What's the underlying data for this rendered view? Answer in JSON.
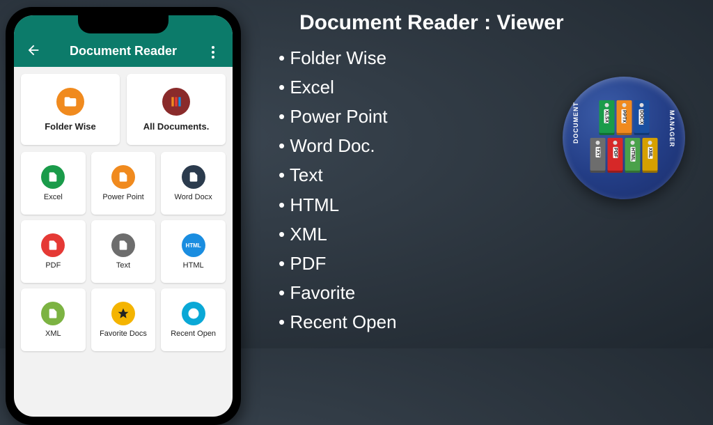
{
  "colors": {
    "header": "#0c7b6a",
    "orange": "#f08a1e",
    "maroon": "#8a2b2b",
    "green": "#1a9b4a",
    "dark": "#2b3b4d",
    "red": "#e53935",
    "gray": "#6d6d6d",
    "blue": "#1a8de0",
    "lime": "#7cb342",
    "yellow": "#f4b400",
    "cyan": "#0aa8d6"
  },
  "phone": {
    "header_title": "Document Reader",
    "top_cards": [
      {
        "label": "Folder Wise"
      },
      {
        "label": "All Documents."
      }
    ],
    "grid": [
      {
        "label": "Excel"
      },
      {
        "label": "Power Point"
      },
      {
        "label": "Word Docx"
      },
      {
        "label": "PDF"
      },
      {
        "label": "Text"
      },
      {
        "label": "HTML"
      },
      {
        "label": "XML"
      },
      {
        "label": "Favorite Docs"
      },
      {
        "label": "Recent Open"
      }
    ]
  },
  "right": {
    "title": "Document Reader : Viewer",
    "features": [
      "Folder Wise",
      "Excel",
      "Power Point",
      "Word Doc.",
      "Text",
      "HTML",
      "XML",
      "PDF",
      "Favorite",
      "Recent Open"
    ]
  },
  "badge": {
    "left_arc": "DOCUMENT",
    "right_arc": "MANAGER",
    "top_binders": [
      "XLSX",
      "PPTX",
      "DOCX"
    ],
    "bottom_binders": [
      "TXT",
      "PDF",
      "HTML",
      "XML"
    ],
    "top_colors": [
      "#1a9b4a",
      "#f08a1e",
      "#1a4fa0"
    ],
    "bottom_colors": [
      "#6d6d6d",
      "#d62828",
      "#4aa14a",
      "#d6a000"
    ]
  }
}
